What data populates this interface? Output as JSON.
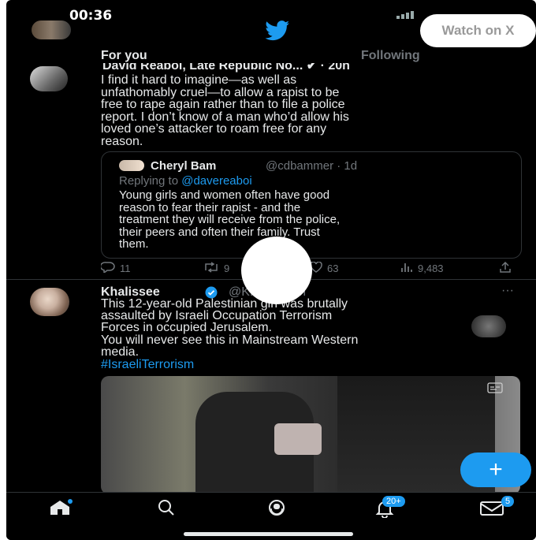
{
  "status": {
    "time": "00:36"
  },
  "header": {
    "watch_label": "Watch on X"
  },
  "tabs": [
    {
      "label": "For you"
    },
    {
      "label": "Following"
    }
  ],
  "tweet1": {
    "name": "David Reaboi, Late Republic No... ✔ · 20h",
    "body": "I find it hard to imagine—as well as\nunfathomably cruel—to allow a rapist to be\nfree to rape again rather than to file a police\nreport. I don’t know of a man who’d allow his\nloved one’s attacker to roam free for any\nreason.",
    "quote": {
      "name": "Cheryl Bam",
      "handle": "@cdbammer · 1d",
      "reply_prefix": "Replying to ",
      "reply_handle": "@davereaboi",
      "body": "Young girls and women often have good\nreason to fear their rapist - and the\ntreatment they will receive from the police,\ntheir peers and often their family.  Trust\nthem."
    },
    "actions": {
      "replies": "11",
      "retweets": "9",
      "likes": "63",
      "views": "9,483"
    }
  },
  "tweet2": {
    "name": "Khalissee",
    "handle": "@K...see · 8h",
    "body": "This 12-year-old Palestinian girl was brutally\nassaulted by Israeli Occupation Terrorism\nForces in occupied Jerusalem.\nYou will never see this in Mainstream Western\nmedia.",
    "hashtag": "#IsraeliTerrorism"
  },
  "nav": {
    "notifications_badge": "20+",
    "messages_badge": "5"
  },
  "colors": {
    "accent": "#1d9bf0",
    "background": "#000000",
    "text": "#e7e9ea",
    "muted": "#71767b"
  }
}
